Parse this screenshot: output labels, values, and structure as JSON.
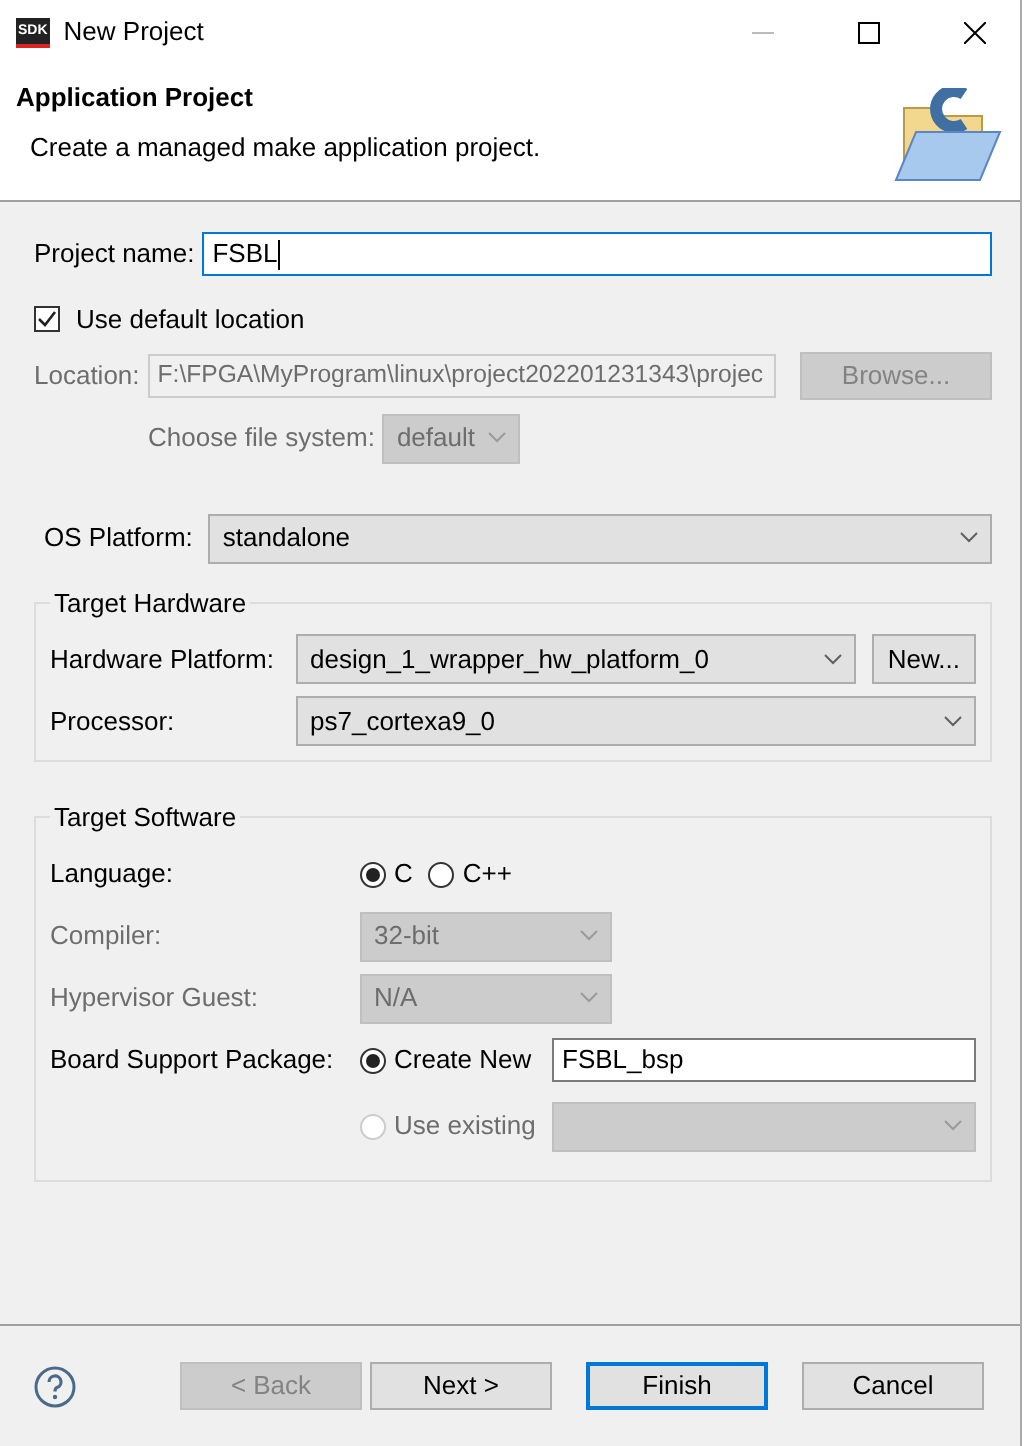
{
  "window": {
    "title": "New Project",
    "app_icon_text": "SDK"
  },
  "header": {
    "title": "Application Project",
    "description": "Create a managed make application project."
  },
  "project_name": {
    "label": "Project name:",
    "value": "FSBL",
    "focused": true
  },
  "use_default_location": {
    "label": "Use default location",
    "checked": true
  },
  "location": {
    "label": "Location:",
    "value": "F:\\FPGA\\MyProgram\\linux\\project202201231343\\projec",
    "disabled": true,
    "button": "Browse..."
  },
  "file_system": {
    "label": "Choose file system:",
    "value": "default",
    "disabled": true
  },
  "os_platform": {
    "label": "OS Platform:",
    "value": "standalone"
  },
  "target_hardware": {
    "title": "Target Hardware",
    "rows": [
      {
        "label": "Hardware Platform:",
        "value": "design_1_wrapper_hw_platform_0",
        "button": "New..."
      },
      {
        "label": "Processor:",
        "value": "ps7_cortexa9_0"
      }
    ]
  },
  "target_software": {
    "title": "Target Software",
    "rows": [
      {
        "kind": "radios",
        "label": "Language:",
        "disabled": false,
        "options": [
          {
            "label": "C",
            "selected": true,
            "disabled": false
          },
          {
            "label": "C++",
            "selected": false,
            "disabled": false
          }
        ]
      },
      {
        "kind": "select",
        "label": "Compiler:",
        "value": "32-bit",
        "disabled": true
      },
      {
        "kind": "select",
        "label": "Hypervisor Guest:",
        "disabled": true,
        "value": "N/A"
      },
      {
        "kind": "bsp",
        "label": "Board Support Package:",
        "disabled": false,
        "options": [
          {
            "label": "Create New",
            "selected": true,
            "disabled": false,
            "kind": "text",
            "value": "FSBL_bsp"
          },
          {
            "label": "Use existing",
            "selected": false,
            "disabled": true,
            "kind": "select"
          }
        ]
      }
    ]
  },
  "buttons": [
    {
      "label": "< Back",
      "disabled": true,
      "default": false
    },
    {
      "label": "Next >",
      "disabled": false,
      "default": false
    },
    {
      "label": "Finish",
      "disabled": false,
      "default": true
    },
    {
      "label": "Cancel",
      "disabled": false,
      "default": false
    }
  ]
}
